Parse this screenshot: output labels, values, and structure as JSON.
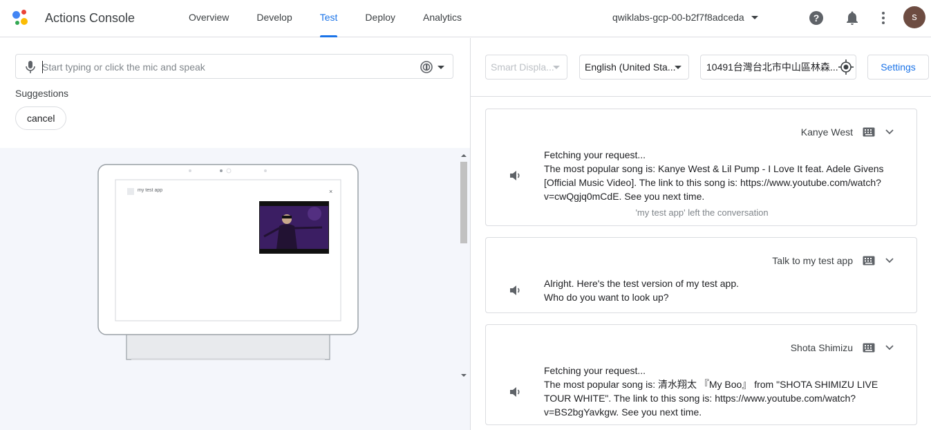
{
  "header": {
    "app_title": "Actions Console",
    "tabs": [
      {
        "label": "Overview"
      },
      {
        "label": "Develop"
      },
      {
        "label": "Test",
        "active": true
      },
      {
        "label": "Deploy"
      },
      {
        "label": "Analytics"
      }
    ],
    "project": "qwiklabs-gcp-00-b2f7f8adceda",
    "avatar_letter": "s",
    "icons": [
      "help-icon",
      "bell-icon",
      "more-vert-icon"
    ]
  },
  "input": {
    "placeholder": "Start typing or click the mic and speak"
  },
  "suggestions": {
    "label": "Suggestions",
    "chips": [
      "cancel"
    ]
  },
  "device_preview": {
    "app_name": "my test app"
  },
  "controls": {
    "surface": "Smart Displa...",
    "language": "English (United Sta...",
    "location": "10491台灣台北市中山區林森...",
    "settings_label": "Settings"
  },
  "conversation": [
    {
      "user": "Kanye West",
      "lines": [
        "Fetching your request...",
        "The most popular song is: Kanye West & Lil Pump - I Love It feat. Adele Givens",
        "[Official Music Video]. The link to this song is: https://www.youtube.com/watch?",
        "v=cwQgjq0mCdE. See you next time."
      ],
      "note": "'my test app' left the conversation"
    },
    {
      "user": "Talk to my test app",
      "lines": [
        "Alright. Here's the test version of my test app.",
        "Who do you want to look up?"
      ]
    },
    {
      "user": "Shota Shimizu",
      "lines": [
        "Fetching your request...",
        "The most popular song is: 清水翔太 『My Boo』 from \"SHOTA SHIMIZU LIVE",
        "TOUR WHITE\". The link to this song is: https://www.youtube.com/watch?",
        "v=BS2bgYavkgw. See you next time."
      ]
    }
  ],
  "colors": {
    "accent": "#1a73e8",
    "border": "#dadce0",
    "simulator_bg": "#f4f6fb",
    "avatar": "#6d4c41"
  }
}
